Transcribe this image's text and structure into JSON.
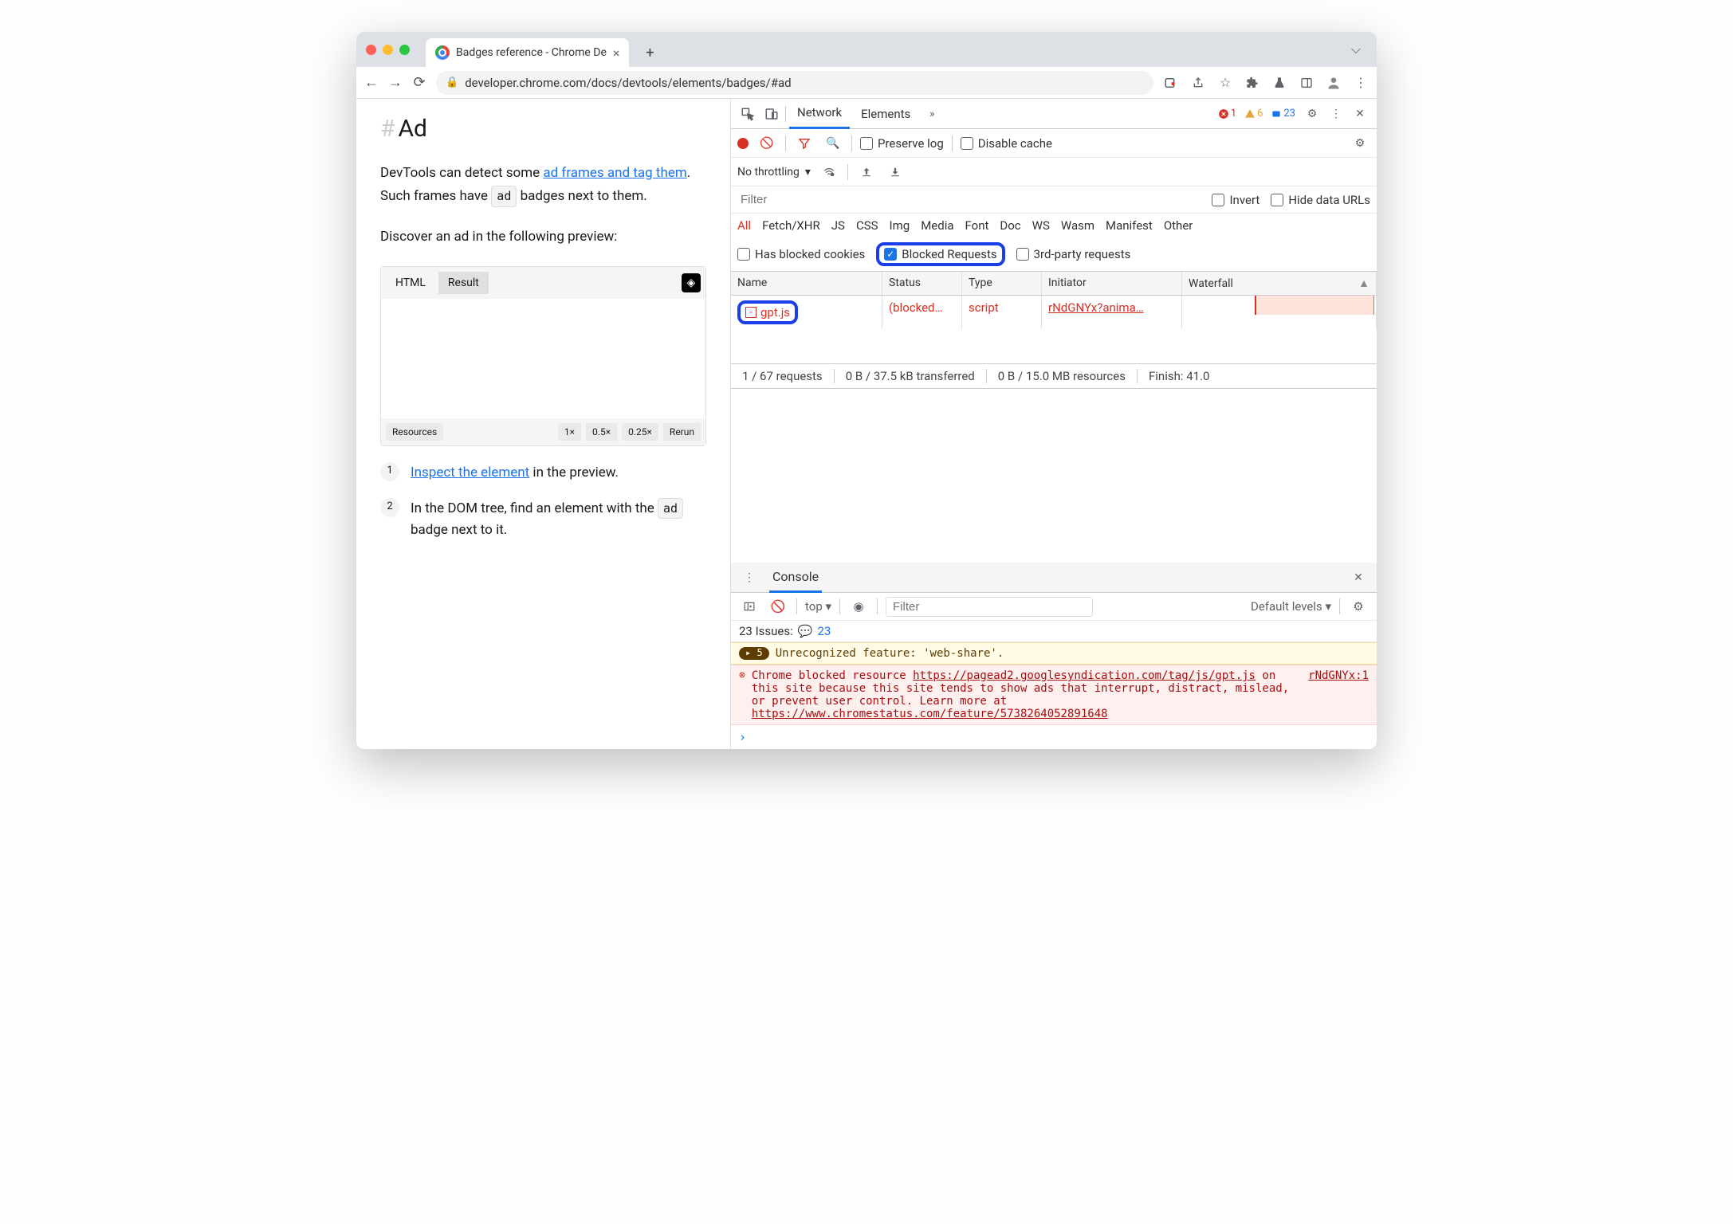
{
  "browser": {
    "tab_title": "Badges reference - Chrome De",
    "url": "developer.chrome.com/docs/devtools/elements/badges/#ad"
  },
  "page": {
    "heading": "Ad",
    "p1_a": "DevTools can detect some ",
    "p1_link": "ad frames and tag them",
    "p1_b": ". Such frames have ",
    "p1_badge": "ad",
    "p1_c": " badges next to them.",
    "p2": "Discover an ad in the following preview:",
    "codepen": {
      "tab_html": "HTML",
      "tab_result": "Result",
      "footer": [
        "Resources",
        "1×",
        "0.5×",
        "0.25×",
        "Rerun"
      ]
    },
    "step1_a": "Inspect the element",
    "step1_b": " in the preview.",
    "step2_a": "In the DOM tree, find an element with the ",
    "step2_badge": "ad",
    "step2_b": " badge next to it."
  },
  "devtools": {
    "tabs": {
      "network": "Network",
      "elements": "Elements"
    },
    "counts": {
      "errors": "1",
      "warnings": "6",
      "info": "23"
    },
    "net_toolbar": {
      "preserve": "Preserve log",
      "disable": "Disable cache",
      "throttling": "No throttling"
    },
    "filter_placeholder": "Filter",
    "filter_invert": "Invert",
    "filter_hide": "Hide data URLs",
    "types": [
      "All",
      "Fetch/XHR",
      "JS",
      "CSS",
      "Img",
      "Media",
      "Font",
      "Doc",
      "WS",
      "Wasm",
      "Manifest",
      "Other"
    ],
    "checks": {
      "blocked_cookies": "Has blocked cookies",
      "blocked_req": "Blocked Requests",
      "third": "3rd-party requests"
    },
    "cols": {
      "name": "Name",
      "status": "Status",
      "type": "Type",
      "initiator": "Initiator",
      "waterfall": "Waterfall"
    },
    "row1": {
      "name": "gpt.js",
      "status": "(blocked…",
      "type": "script",
      "initiator": "rNdGNYx?anima…"
    },
    "status_bar": {
      "req": "1 / 67 requests",
      "xfer": "0 B / 37.5 kB transferred",
      "res": "0 B / 15.0 MB resources",
      "fin": "Finish: 41.0"
    },
    "console": {
      "title": "Console",
      "context": "top ▾",
      "filter": "Filter",
      "levels": "Default levels ▾",
      "issues_label": "23 Issues:",
      "issues_count": "23",
      "warn_count": "5",
      "warn_msg": "Unrecognized feature: 'web-share'.",
      "err_pre": "Chrome blocked resource ",
      "err_url": "https://pagead2.googlesyndication.com/tag/js/gpt.js",
      "err_loc": "rNdGNYx:1",
      "err_mid": " on this site because this site tends to show ads that interrupt, distract, mislead, or prevent user control. Learn more at ",
      "err_learn": "https://www.chromestatus.com/feature/5738264052891648"
    }
  }
}
